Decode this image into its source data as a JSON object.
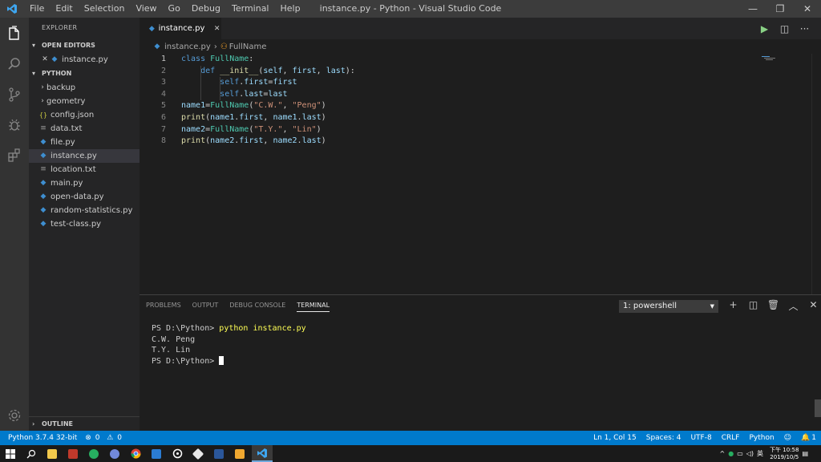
{
  "window": {
    "title": "instance.py - Python - Visual Studio Code"
  },
  "menu": [
    "File",
    "Edit",
    "Selection",
    "View",
    "Go",
    "Debug",
    "Terminal",
    "Help"
  ],
  "window_controls": {
    "minimize": "—",
    "restore": "❐",
    "close": "✕"
  },
  "sidebar": {
    "title": "EXPLORER",
    "open_editors_label": "OPEN EDITORS",
    "open_editors": [
      {
        "name": "instance.py"
      }
    ],
    "folder_label": "PYTHON",
    "folders": [
      {
        "name": "backup"
      },
      {
        "name": "geometry"
      }
    ],
    "files": [
      {
        "name": "config.json",
        "icon": "{}"
      },
      {
        "name": "data.txt",
        "icon": "≡"
      },
      {
        "name": "file.py",
        "icon": "◆"
      },
      {
        "name": "instance.py",
        "icon": "◆"
      },
      {
        "name": "location.txt",
        "icon": "≡"
      },
      {
        "name": "main.py",
        "icon": "◆"
      },
      {
        "name": "open-data.py",
        "icon": "◆"
      },
      {
        "name": "random-statistics.py",
        "icon": "◆"
      },
      {
        "name": "test-class.py",
        "icon": "◆"
      }
    ],
    "outline_label": "OUTLINE"
  },
  "editor": {
    "tab_name": "instance.py",
    "breadcrumb": {
      "file": "instance.py",
      "symbol": "FullName"
    },
    "lines": [
      {
        "n": "1",
        "t": [
          {
            "c": "k",
            "v": "class "
          },
          {
            "c": "cls",
            "v": "FullName"
          },
          {
            "c": "plain",
            "v": ":"
          }
        ]
      },
      {
        "n": "2",
        "t": [
          {
            "c": "plain",
            "v": "    "
          },
          {
            "c": "k",
            "v": "def "
          },
          {
            "c": "fn",
            "v": "__init__"
          },
          {
            "c": "plain",
            "v": "("
          },
          {
            "c": "pm",
            "v": "self"
          },
          {
            "c": "plain",
            "v": ", "
          },
          {
            "c": "pm",
            "v": "first"
          },
          {
            "c": "plain",
            "v": ", "
          },
          {
            "c": "pm",
            "v": "last"
          },
          {
            "c": "plain",
            "v": "):"
          }
        ]
      },
      {
        "n": "3",
        "t": [
          {
            "c": "plain",
            "v": "        "
          },
          {
            "c": "k",
            "v": "self"
          },
          {
            "c": "plain",
            "v": "."
          },
          {
            "c": "pm",
            "v": "first"
          },
          {
            "c": "plain",
            "v": "="
          },
          {
            "c": "pm",
            "v": "first"
          }
        ]
      },
      {
        "n": "4",
        "t": [
          {
            "c": "plain",
            "v": "        "
          },
          {
            "c": "k",
            "v": "self"
          },
          {
            "c": "plain",
            "v": "."
          },
          {
            "c": "pm",
            "v": "last"
          },
          {
            "c": "plain",
            "v": "="
          },
          {
            "c": "pm",
            "v": "last"
          }
        ]
      },
      {
        "n": "5",
        "t": [
          {
            "c": "pm",
            "v": "name1"
          },
          {
            "c": "plain",
            "v": "="
          },
          {
            "c": "cls",
            "v": "FullName"
          },
          {
            "c": "plain",
            "v": "("
          },
          {
            "c": "s",
            "v": "\"C.W.\""
          },
          {
            "c": "plain",
            "v": ", "
          },
          {
            "c": "s",
            "v": "\"Peng\""
          },
          {
            "c": "plain",
            "v": ")"
          }
        ]
      },
      {
        "n": "6",
        "t": [
          {
            "c": "fn",
            "v": "print"
          },
          {
            "c": "plain",
            "v": "("
          },
          {
            "c": "pm",
            "v": "name1"
          },
          {
            "c": "plain",
            "v": "."
          },
          {
            "c": "pm",
            "v": "first"
          },
          {
            "c": "plain",
            "v": ", "
          },
          {
            "c": "pm",
            "v": "name1"
          },
          {
            "c": "plain",
            "v": "."
          },
          {
            "c": "pm",
            "v": "last"
          },
          {
            "c": "plain",
            "v": ")"
          }
        ]
      },
      {
        "n": "7",
        "t": [
          {
            "c": "pm",
            "v": "name2"
          },
          {
            "c": "plain",
            "v": "="
          },
          {
            "c": "cls",
            "v": "FullName"
          },
          {
            "c": "plain",
            "v": "("
          },
          {
            "c": "s",
            "v": "\"T.Y.\""
          },
          {
            "c": "plain",
            "v": ", "
          },
          {
            "c": "s",
            "v": "\"Lin\""
          },
          {
            "c": "plain",
            "v": ")"
          }
        ]
      },
      {
        "n": "8",
        "t": [
          {
            "c": "fn",
            "v": "print"
          },
          {
            "c": "plain",
            "v": "("
          },
          {
            "c": "pm",
            "v": "name2"
          },
          {
            "c": "plain",
            "v": "."
          },
          {
            "c": "pm",
            "v": "first"
          },
          {
            "c": "plain",
            "v": ", "
          },
          {
            "c": "pm",
            "v": "name2"
          },
          {
            "c": "plain",
            "v": "."
          },
          {
            "c": "pm",
            "v": "last"
          },
          {
            "c": "plain",
            "v": ")"
          }
        ]
      }
    ]
  },
  "panel": {
    "tabs": [
      "PROBLEMS",
      "OUTPUT",
      "DEBUG CONSOLE",
      "TERMINAL"
    ],
    "active_tab": "TERMINAL",
    "terminal_select": "1: powershell",
    "terminal": {
      "prompt": "PS D:\\Python> ",
      "command": "python instance.py",
      "output": [
        "C.W. Peng",
        "T.Y. Lin"
      ]
    }
  },
  "status_bar": {
    "interpreter": "Python 3.7.4 32-bit",
    "errors": "0",
    "warnings": "0",
    "position": "Ln 1, Col 15",
    "spaces": "Spaces: 4",
    "encoding": "UTF-8",
    "eol": "CRLF",
    "language": "Python",
    "notifications": "1"
  },
  "taskbar": {
    "ime": "英",
    "time": "下午 10:58",
    "date": "2019/10/5"
  },
  "colors": {
    "accent": "#007acc",
    "title_bar": "#3c3c3c",
    "activity_bar": "#333333",
    "sidebar": "#252526",
    "editor": "#1e1e1e"
  }
}
